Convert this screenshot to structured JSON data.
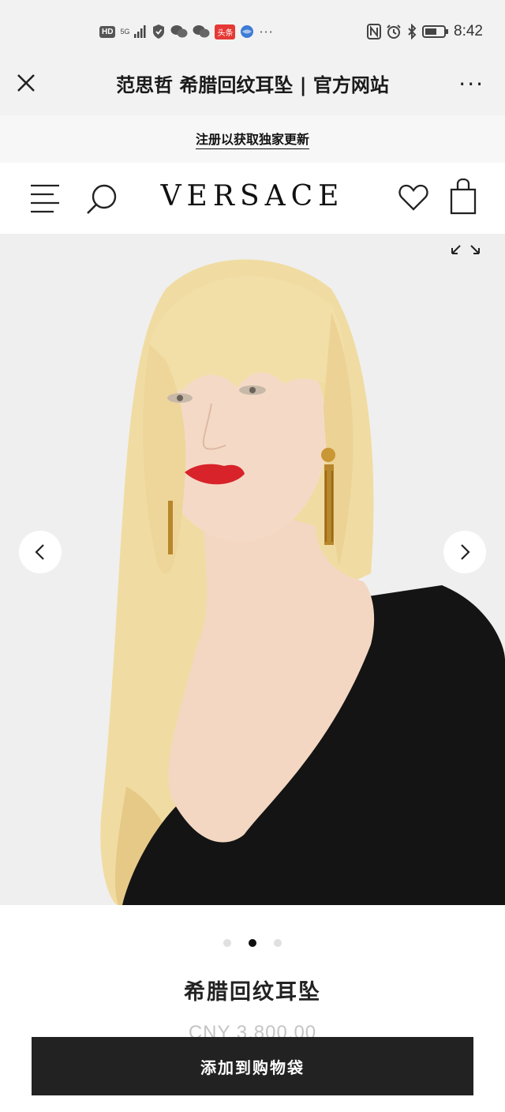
{
  "status_bar": {
    "hd_label": "HD",
    "net_label": "5G",
    "news_badge": "头条",
    "dots": "···",
    "time": "8:42"
  },
  "titlebar": {
    "title": "范思哲 希腊回纹耳坠 | 官方网站",
    "more_label": "···"
  },
  "promo": {
    "link_text": "注册以获取独家更新"
  },
  "header": {
    "logo_text": "VERSACE"
  },
  "gallery": {
    "current_slide": 2,
    "total_slides": 3
  },
  "product": {
    "name": "希腊回纹耳坠",
    "price": "CNY 3,800.00"
  },
  "cta": {
    "add_to_bag_label": "添加到购物袋"
  },
  "colors": {
    "button_bg": "#222222",
    "gallery_bg": "#efefef",
    "lip": "#d8232a",
    "hair": "#f0dca2",
    "earring_gold": "#b8862b"
  }
}
